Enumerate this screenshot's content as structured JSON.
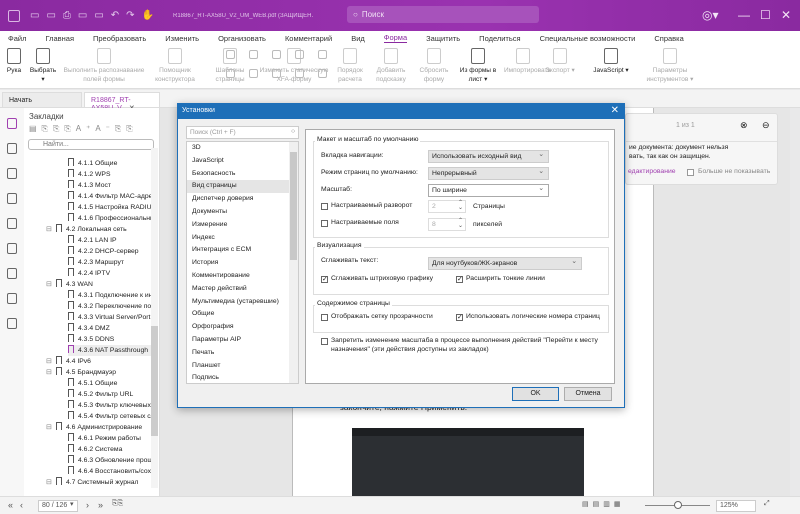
{
  "titlebar": {
    "doc_title": "R18867_RT-AX58U_V2_UM_WEB.pdf (ЗАЩИЩЕН...",
    "search_placeholder": "Поиск"
  },
  "menu": [
    "Файл",
    "Главная",
    "Преобразовать",
    "Изменить",
    "Организовать",
    "Комментарий",
    "Вид",
    "Форма",
    "Защитить",
    "Поделиться",
    "Специальные возможности",
    "Справка"
  ],
  "menu_active": "Форма",
  "ribbon": [
    {
      "label": "Рука",
      "enabled": true
    },
    {
      "label": "Выбрать ▾",
      "enabled": true
    },
    {
      "label": "Выполнить распознавание полей формы",
      "enabled": false
    },
    {
      "label": "Помощник конструктора",
      "enabled": false
    },
    {
      "label": "Шаблоны страницы",
      "enabled": false
    },
    {
      "label": "Изменить статическую XFA-форму",
      "enabled": false
    },
    {
      "label": "Порядок расчета",
      "enabled": false
    },
    {
      "label": "Добавить подсказку",
      "enabled": false
    },
    {
      "label": "Сбросить форму",
      "enabled": false
    },
    {
      "label": "Из формы в лист ▾",
      "enabled": true
    },
    {
      "label": "Импортировать",
      "enabled": false
    },
    {
      "label": "Экспорт ▾",
      "enabled": false
    },
    {
      "label": "JavaScript ▾",
      "enabled": true
    },
    {
      "label": "Параметры инструментов ▾",
      "enabled": false
    }
  ],
  "tabs": {
    "start": "Начать",
    "doc": "R18867_RT-AX58U_V..."
  },
  "bookmarks": {
    "title": "Закладки",
    "search_placeholder": "Найти...",
    "items": [
      {
        "label": "4.1.1 Общие",
        "level": 2
      },
      {
        "label": "4.1.2 WPS",
        "level": 2
      },
      {
        "label": "4.1.3 Мост",
        "level": 2
      },
      {
        "label": "4.1.4 Фильтр MAC-адресов",
        "level": 2
      },
      {
        "label": "4.1.5 Настройка RADIUS",
        "level": 2
      },
      {
        "label": "4.1.6 Профессиональный",
        "level": 2
      },
      {
        "label": "4.2 Локальная сеть",
        "level": 1
      },
      {
        "label": "4.2.1 LAN IP",
        "level": 2
      },
      {
        "label": "4.2.2 DHCP-сервер",
        "level": 2
      },
      {
        "label": "4.2.3 Маршрут",
        "level": 2
      },
      {
        "label": "4.2.4 IPTV",
        "level": 2
      },
      {
        "label": "4.3 WAN",
        "level": 1
      },
      {
        "label": "4.3.1 Подключение к интер",
        "level": 2
      },
      {
        "label": "4.3.2 Переключение порто",
        "level": 2
      },
      {
        "label": "4.3.3 Virtual Server/Port For",
        "level": 2
      },
      {
        "label": "4.3.4 DMZ",
        "level": 2
      },
      {
        "label": "4.3.5 DDNS",
        "level": 2
      },
      {
        "label": "4.3.6 NAT Passthrough",
        "level": 2,
        "selected": true
      },
      {
        "label": "4.4 IPv6",
        "level": 1
      },
      {
        "label": "4.5 Брандмауэр",
        "level": 1
      },
      {
        "label": "4.5.1 Общие",
        "level": 2
      },
      {
        "label": "4.5.2 Фильтр URL",
        "level": 2
      },
      {
        "label": "4.5.3 Фильтр ключевых сл",
        "level": 2
      },
      {
        "label": "4.5.4 Фильтр сетевых служ",
        "level": 2
      },
      {
        "label": "4.6 Администрирование",
        "level": 1
      },
      {
        "label": "4.6.1 Режим работы",
        "level": 2
      },
      {
        "label": "4.6.2 Система",
        "level": 2
      },
      {
        "label": "4.6.3 Обновление прошив",
        "level": 2
      },
      {
        "label": "4.6.4 Восстановить/сохран",
        "level": 2
      },
      {
        "label": "4.7 Системный журнал",
        "level": 1
      }
    ]
  },
  "notification": {
    "pager": "1 из 1",
    "line1": "ие документа: документ нельзя",
    "line2": "вать, так как он защищен.",
    "link": "едактирование",
    "dont_show": "Больше не показывать"
  },
  "page": {
    "text": "закончите, нажмите Применить."
  },
  "dialog": {
    "title": "Установки",
    "search_placeholder": "Поиск (Ctrl + F)",
    "categories": [
      "3D",
      "JavaScript",
      "Безопасность",
      "Вид страницы",
      "Диспетчер доверия",
      "Документы",
      "Измерение",
      "Индекс",
      "Интеграция с ECM",
      "История",
      "Комментирование",
      "Мастер действий",
      "Мультимедиа (устаревшие)",
      "Общие",
      "Орфография",
      "Параметры AIP",
      "Печать",
      "Планшет",
      "Подпись"
    ],
    "selected_category": "Вид страницы",
    "group1": {
      "title": "Макет и масштаб по умолчанию",
      "nav_label": "Вкладка навигации:",
      "nav_value": "Использовать исходный вид",
      "mode_label": "Режим страниц по умолчанию:",
      "mode_value": "Непрерывный",
      "zoom_label": "Масштаб:",
      "zoom_value": "По ширине",
      "spread_label": "Настраиваемый разворот",
      "spread_value": "2",
      "spread_unit": "Страницы",
      "margins_label": "Настраиваемые поля",
      "margins_value": "8",
      "margins_unit": "пикселей",
      "spread_checked": false,
      "margins_checked": false
    },
    "group2": {
      "title": "Визуализация",
      "smooth_label": "Сглаживать текст:",
      "smooth_value": "Для ноутбуков/ЖК-экранов",
      "line_art": "Сглаживать штриховую графику",
      "line_art_checked": true,
      "thin_lines": "Расширить тонкие линии",
      "thin_lines_checked": true
    },
    "group3": {
      "title": "Содержимое страницы",
      "grid": "Отображать сетку прозрачности",
      "grid_checked": false,
      "logical": "Использовать логические номера страниц",
      "logical_checked": true
    },
    "prevent_zoom": "Запретить изменение масштаба в процессе выполнения действий \"Перейти к месту назначения\" (эти действия доступны из закладок)",
    "prevent_zoom_checked": false,
    "ok": "OK",
    "cancel": "Отмена"
  },
  "status": {
    "page": "80 / 126",
    "zoom": "125%",
    "zoom_slider_percent": 50
  }
}
